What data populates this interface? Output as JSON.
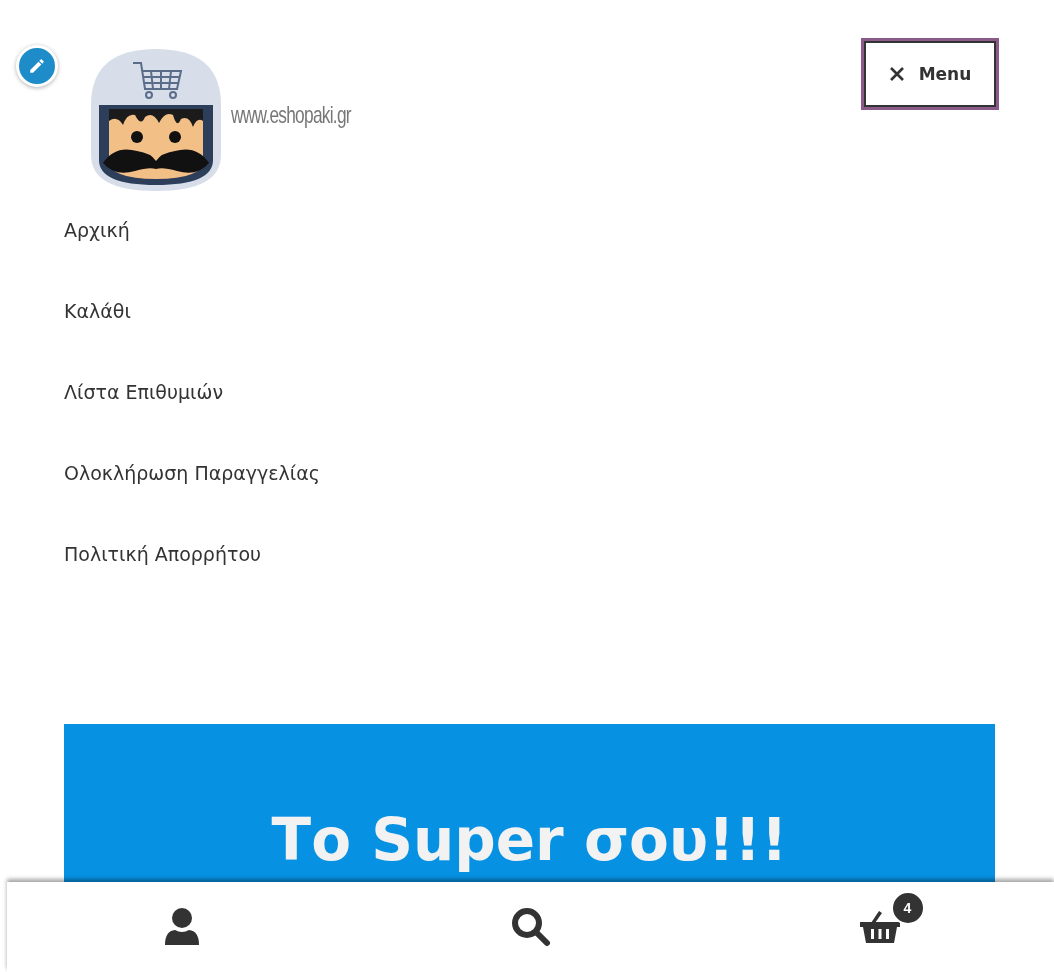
{
  "header": {
    "logo_text": "www.eshopaki.gr",
    "menu_button": {
      "label": "Menu",
      "expanded": true
    }
  },
  "nav": {
    "items": [
      {
        "label": "Αρχική"
      },
      {
        "label": "Καλάθι"
      },
      {
        "label": "Λίστα Επιθυμιών"
      },
      {
        "label": "Ολοκλήρωση Παραγγελίας"
      },
      {
        "label": "Πολιτική Απορρήτου"
      }
    ]
  },
  "banner": {
    "title": "Το Super σου!!!"
  },
  "footer_bar": {
    "cart_count": "4"
  }
}
